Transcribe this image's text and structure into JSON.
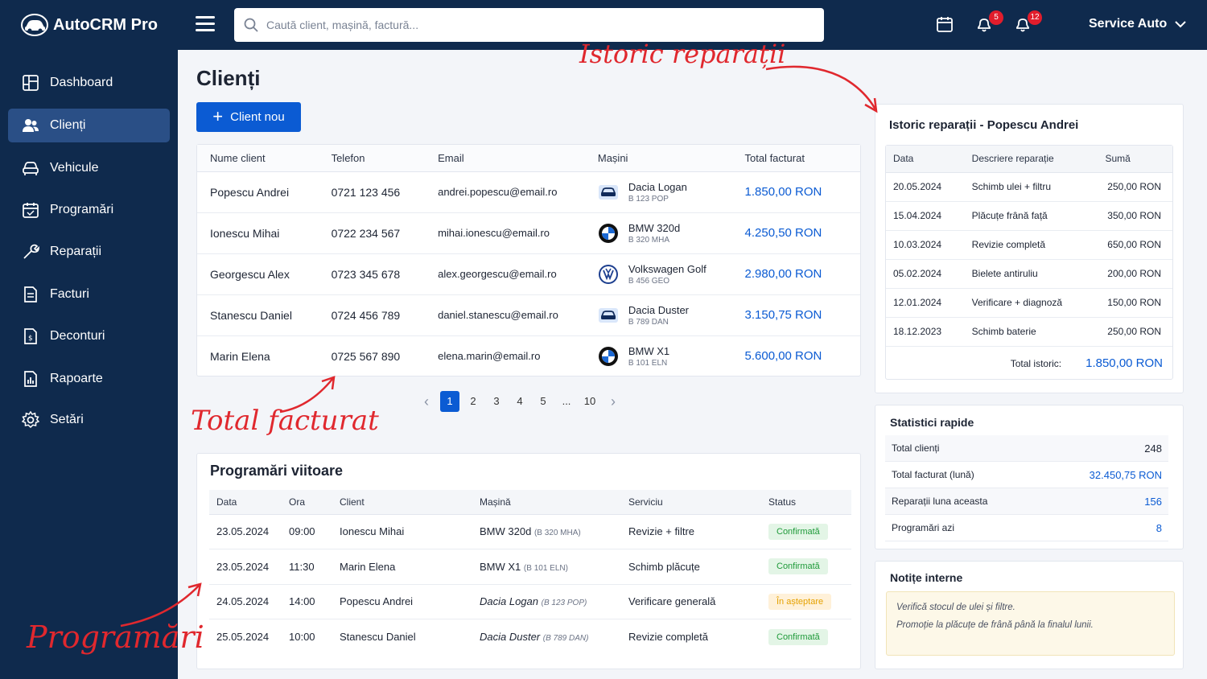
{
  "app": {
    "name": "AutoCRM Pro"
  },
  "search": {
    "placeholder": "Caută client, mașină, factură..."
  },
  "header": {
    "notifications_count": "5",
    "alerts_count": "12",
    "account_label": "Service Auto"
  },
  "sidebar": {
    "items": [
      {
        "label": "Dashboard",
        "icon": "dashboard-icon"
      },
      {
        "label": "Clienți",
        "icon": "users-icon"
      },
      {
        "label": "Vehicule",
        "icon": "car-icon"
      },
      {
        "label": "Programări",
        "icon": "calendar-icon"
      },
      {
        "label": "Reparații",
        "icon": "wrench-icon"
      },
      {
        "label": "Facturi",
        "icon": "invoice-icon"
      },
      {
        "label": "Deconturi",
        "icon": "document-icon"
      },
      {
        "label": "Rapoarte",
        "icon": "report-icon"
      },
      {
        "label": "Setări",
        "icon": "gear-icon"
      }
    ]
  },
  "page": {
    "title": "Clienți",
    "new_client_label": "Client nou"
  },
  "clients": {
    "headers": [
      "Nume client",
      "Telefon",
      "Email",
      "Mașini",
      "Total facturat"
    ],
    "rows": [
      {
        "name": "Popescu Andrei",
        "phone": "0721 123 456",
        "email": "andrei.popescu@email.ro",
        "car": "Dacia Logan",
        "plate": "B 123 POP",
        "brand": "dacia",
        "total": "1.850,00 RON"
      },
      {
        "name": "Ionescu Mihai",
        "phone": "0722 234 567",
        "email": "mihai.ionescu@email.ro",
        "car": "BMW 320d",
        "plate": "B 320 MHA",
        "brand": "bmw",
        "total": "4.250,50 RON"
      },
      {
        "name": "Georgescu Alex",
        "phone": "0723 345 678",
        "email": "alex.georgescu@email.ro",
        "car": "Volkswagen Golf",
        "plate": "B 456 GEO",
        "brand": "vw",
        "total": "2.980,00 RON"
      },
      {
        "name": "Stanescu Daniel",
        "phone": "0724 456 789",
        "email": "daniel.stanescu@email.ro",
        "car": "Dacia Duster",
        "plate": "B 789 DAN",
        "brand": "dacia",
        "total": "3.150,75 RON"
      },
      {
        "name": "Marin Elena",
        "phone": "0725 567 890",
        "email": "elena.marin@email.ro",
        "car": "BMW X1",
        "plate": "B 101 ELN",
        "brand": "bmw",
        "total": "5.600,00 RON"
      }
    ]
  },
  "pagination": {
    "prev": "‹",
    "pages": [
      "1",
      "2",
      "3",
      "4",
      "5",
      "...",
      "10"
    ],
    "current": "1",
    "next": "›"
  },
  "appointments": {
    "title": "Programări viitoare",
    "headers": [
      "Data",
      "Ora",
      "Client",
      "Mașină",
      "Serviciu",
      "Status"
    ],
    "rows": [
      {
        "date": "23.05.2024",
        "time": "09:00",
        "client": "Ionescu Mihai",
        "car": "BMW 320d",
        "plate": "(B 320 MHA)",
        "service": "Revizie + filtre",
        "status": "Confirmată",
        "status_kind": "ok"
      },
      {
        "date": "23.05.2024",
        "time": "11:30",
        "client": "Marin Elena",
        "car": "BMW X1",
        "plate": "(B 101 ELN)",
        "service": "Schimb plăcuțe",
        "status": "Confirmată",
        "status_kind": "ok"
      },
      {
        "date": "24.05.2024",
        "time": "14:00",
        "client": "Popescu Andrei",
        "car": "Dacia Logan",
        "plate": "(B 123 POP)",
        "service": "Verificare generală",
        "status": "În așteptare",
        "status_kind": "wait"
      },
      {
        "date": "25.05.2024",
        "time": "10:00",
        "client": "Stanescu Daniel",
        "car": "Dacia Duster",
        "plate": "(B 789 DAN)",
        "service": "Revizie completă",
        "status": "Confirmată",
        "status_kind": "ok"
      }
    ]
  },
  "history": {
    "title": "Istoric reparații - Popescu Andrei",
    "headers": [
      "Data",
      "Descriere reparație",
      "Sumă"
    ],
    "rows": [
      {
        "date": "20.05.2024",
        "desc": "Schimb ulei + filtru",
        "sum": "250,00 RON"
      },
      {
        "date": "15.04.2024",
        "desc": "Plăcuțe frână față",
        "sum": "350,00 RON"
      },
      {
        "date": "10.03.2024",
        "desc": "Revizie completă",
        "sum": "650,00 RON"
      },
      {
        "date": "05.02.2024",
        "desc": "Bielete antiruliu",
        "sum": "200,00 RON"
      },
      {
        "date": "12.01.2024",
        "desc": "Verificare + diagnoză",
        "sum": "150,00 RON"
      },
      {
        "date": "18.12.2023",
        "desc": "Schimb baterie",
        "sum": "250,00 RON"
      }
    ],
    "total_label": "Total istoric:",
    "total_value": "1.850,00 RON"
  },
  "stats": {
    "title": "Statistici rapide",
    "rows": [
      {
        "label": "Total clienți",
        "value": "248",
        "blue": false
      },
      {
        "label": "Total facturat (lună)",
        "value": "32.450,75 RON",
        "blue": true
      },
      {
        "label": "Reparații luna aceasta",
        "value": "156",
        "blue": true
      },
      {
        "label": "Programări azi",
        "value": "8",
        "blue": true
      }
    ]
  },
  "notes": {
    "title": "Notițe interne",
    "lines": [
      "Verifică stocul de ulei și filtre.",
      "Promoție la plăcuțe de frână până la finalul lunii."
    ]
  },
  "annotations": {
    "history": "Istoric reparații",
    "total": "Total facturat",
    "appointments": "Programări"
  },
  "colors": {
    "navy": "#0f2a4d",
    "accent": "#0b5bd3",
    "annotation": "#e0282e",
    "confirmed": "#1f9a3a",
    "pending": "#e5a100"
  }
}
